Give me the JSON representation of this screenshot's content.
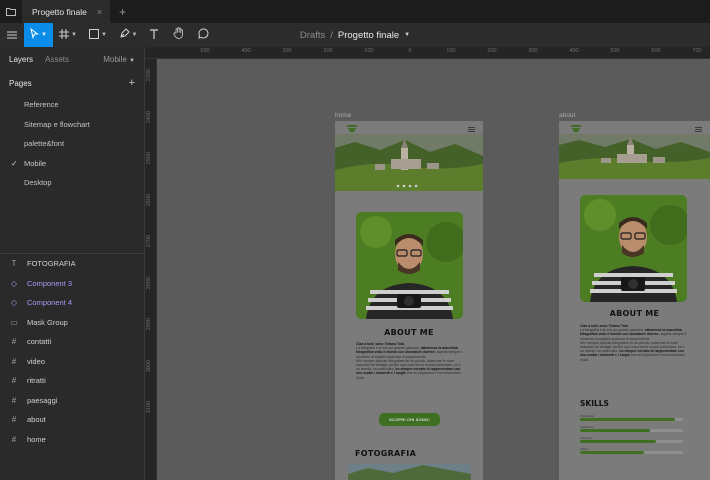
{
  "titlebar": {
    "tab_title": "Progetto finale"
  },
  "toolbar": {
    "breadcrumb_parent": "Drafts",
    "breadcrumb_separator": "/",
    "file_name": "Progetto finale"
  },
  "left_panel": {
    "tabs": {
      "layers": "Layers",
      "assets": "Assets",
      "device": "Mobile"
    },
    "pages_title": "Pages",
    "pages": [
      {
        "label": "Reference",
        "selected": false
      },
      {
        "label": "Sitemap e flowchart",
        "selected": false
      },
      {
        "label": "palette&font",
        "selected": false
      },
      {
        "label": "Mobile",
        "selected": true
      },
      {
        "label": "Desktop",
        "selected": false
      }
    ],
    "layers": [
      {
        "label": "FOTOGRAFIA",
        "icon": "text-icon",
        "type": "text"
      },
      {
        "label": "Component 3",
        "icon": "component-icon",
        "type": "component"
      },
      {
        "label": "Component 4",
        "icon": "component-icon",
        "type": "component"
      },
      {
        "label": "Mask Group",
        "icon": "mask-icon",
        "type": "mask"
      },
      {
        "label": "contatti",
        "icon": "frame-icon",
        "type": "frame"
      },
      {
        "label": "video",
        "icon": "frame-icon",
        "type": "frame"
      },
      {
        "label": "ritratti",
        "icon": "frame-icon",
        "type": "frame"
      },
      {
        "label": "paesaggi",
        "icon": "frame-icon",
        "type": "frame"
      },
      {
        "label": "about",
        "icon": "frame-icon",
        "type": "frame"
      },
      {
        "label": "home",
        "icon": "frame-icon",
        "type": "frame"
      }
    ]
  },
  "rulers": {
    "top": [
      "500",
      "400",
      "300",
      "200",
      "100",
      "0",
      "100",
      "200",
      "300",
      "400",
      "500",
      "600",
      "700"
    ],
    "left": [
      "2300",
      "2400",
      "2500",
      "2600",
      "2700",
      "2800",
      "2900",
      "3000",
      "3100"
    ]
  },
  "canvas": {
    "frames": {
      "home": {
        "label": "home",
        "about_title": "ABOUT ME",
        "intro": "Ciao a tutti, sono Tiziano Tola.",
        "cta": "SCOPRI CHI SONO!",
        "fotografia_title": "FOTOGRAFIA"
      },
      "about": {
        "label": "about",
        "about_title": "ABOUT ME",
        "intro": "Ciao a tutti, sono Tiziano Tola.",
        "skills_title": "SKILLS",
        "skills": [
          {
            "label": "Photoshop",
            "level": 0.92
          },
          {
            "label": "Lightroom",
            "level": 0.68
          },
          {
            "label": "Premiere",
            "level": 0.74
          },
          {
            "label": "Video",
            "level": 0.62
          }
        ]
      }
    },
    "shared_text": {
      "paragraph_a": "La fotografia è la mia più grande passione,",
      "paragraph_a_bold": "attraverso la macchina fotografica vedo il mondo con sfumature diverse",
      "paragraph_a_end": ", aspetto sempre il momento di cogliere qualcosa di sorprendente.",
      "paragraph_b": "Mi è sempre piaciuto fotografare fin da piccolo, osservare le cose nascoste nei dettagli; perché ogni cosa ha un mondo particolare, ed è un mondo: un particolare,",
      "paragraph_b_bold": "ho sempre cercato di rappresentare con uno scatto i momenti e i luoghi",
      "paragraph_b_end": "che mi colpiscono e mi emozionano di più."
    }
  },
  "colors": {
    "accent": "#0c8ce9",
    "brand_green": "#3e6f23",
    "component_purple": "#a995f3"
  }
}
